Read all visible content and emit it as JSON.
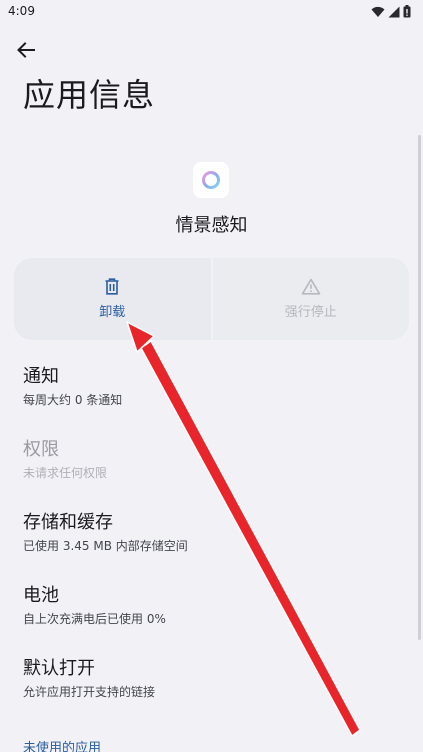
{
  "status_bar": {
    "time": "4:09",
    "icons": [
      "wifi-icon",
      "signal-icon",
      "battery-icon"
    ]
  },
  "header": {
    "back_icon": "arrow-back-icon",
    "title": "应用信息"
  },
  "app": {
    "name": "情景感知",
    "icon": "ring-app-icon"
  },
  "actions": [
    {
      "label": "卸载",
      "icon": "trash-icon",
      "enabled": true
    },
    {
      "label": "强行停止",
      "icon": "warning-icon",
      "enabled": false
    }
  ],
  "settings": [
    {
      "title": "通知",
      "subtitle": "每周大约 0 条通知",
      "enabled": true
    },
    {
      "title": "权限",
      "subtitle": "未请求任何权限",
      "enabled": false
    },
    {
      "title": "存储和缓存",
      "subtitle": "已使用 3.45 MB 内部存储空间",
      "enabled": true
    },
    {
      "title": "电池",
      "subtitle": "自上次充满电后已使用 0%",
      "enabled": true
    },
    {
      "title": "默认打开",
      "subtitle": "允许应用打开支持的链接",
      "enabled": true
    }
  ],
  "section_header": "未使用的应用",
  "colors": {
    "background": "#f1f1f6",
    "accent": "#2b5e9e",
    "annotation_arrow": "#e8252a"
  }
}
